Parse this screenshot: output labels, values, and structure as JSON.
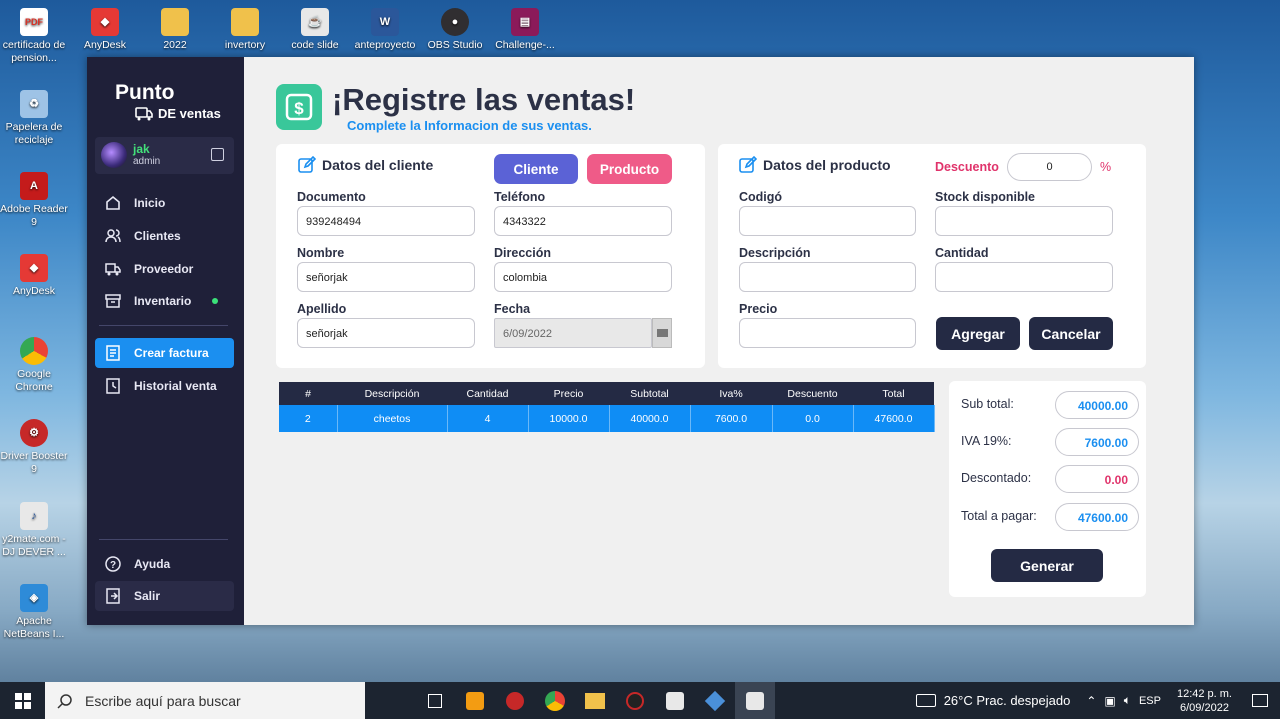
{
  "desktop_icons": [
    {
      "label": "certificado de pension...",
      "icon": "pdf-icon",
      "color": "#d93025",
      "glyph": "PDF"
    },
    {
      "label": "AnyDesk",
      "icon": "anydesk-icon",
      "color": "#e53935",
      "glyph": "◆"
    },
    {
      "label": "2022",
      "icon": "folder-icon",
      "color": "#f0c14b",
      "glyph": ""
    },
    {
      "label": "invertory",
      "icon": "folder-icon",
      "color": "#f0c14b",
      "glyph": ""
    },
    {
      "label": "code slide",
      "icon": "java-icon",
      "color": "#e8e8e8",
      "glyph": "☕"
    },
    {
      "label": "anteproyecto",
      "icon": "word-icon",
      "color": "#2b579a",
      "glyph": "W"
    },
    {
      "label": "OBS Studio",
      "icon": "obs-icon",
      "color": "#302e31",
      "glyph": "●"
    },
    {
      "label": "Challenge-...",
      "icon": "winrar-icon",
      "color": "#8b1a5a",
      "glyph": "▤"
    },
    {
      "label": "Papelera de reciclaje",
      "icon": "recycle-bin-icon",
      "color": "#9ec3e6",
      "glyph": "♻"
    },
    {
      "label": "Adobe Reader 9",
      "icon": "adobe-reader-icon",
      "color": "#c41b1b",
      "glyph": "A"
    },
    {
      "label": "AnyDesk",
      "icon": "anydesk-icon",
      "color": "#e53935",
      "glyph": "◆"
    },
    {
      "label": "Google Chrome",
      "icon": "chrome-icon",
      "color": "#4285f4",
      "glyph": "●"
    },
    {
      "label": "Driver Booster 9",
      "icon": "driver-booster-icon",
      "color": "#c62828",
      "glyph": "⚙"
    },
    {
      "label": "y2mate.com - DJ DEVER ...",
      "icon": "mp3-icon",
      "color": "#e8e8e8",
      "glyph": "♪"
    },
    {
      "label": "Apache NetBeans I...",
      "icon": "netbeans-icon",
      "color": "#2e8bd8",
      "glyph": "◈"
    }
  ],
  "sidebar": {
    "brand_line1": "Punto",
    "brand_line2": "DE ventas",
    "user_name": "jak",
    "user_role": "admin",
    "nav": [
      {
        "label": "Inicio",
        "icon": "home-icon"
      },
      {
        "label": "Clientes",
        "icon": "users-icon"
      },
      {
        "label": "Proveedor",
        "icon": "truck-icon"
      },
      {
        "label": "Inventario",
        "icon": "archive-icon"
      },
      {
        "label": "Crear factura",
        "icon": "invoice-icon"
      },
      {
        "label": "Historial venta",
        "icon": "history-icon"
      }
    ],
    "help_label": "Ayuda",
    "logout_label": "Salir"
  },
  "header": {
    "title": "¡Registre las ventas!",
    "subtitle": "Complete la Informacion de sus ventas."
  },
  "client": {
    "title": "Datos del cliente",
    "tab_cliente": "Cliente",
    "tab_producto": "Producto",
    "documento_label": "Documento",
    "documento_value": "939248494",
    "telefono_label": "Teléfono",
    "telefono_value": "4343322",
    "nombre_label": "Nombre",
    "nombre_value": "señorjak",
    "direccion_label": "Dirección",
    "direccion_value": "colombia",
    "apellido_label": "Apellido",
    "apellido_value": "señorjak",
    "fecha_label": "Fecha",
    "fecha_value": "6/09/2022"
  },
  "product": {
    "title": "Datos del producto",
    "descuento_label": "Descuento",
    "descuento_value": "0",
    "percent": "%",
    "codigo_label": "Codigó",
    "stock_label": "Stock disponible",
    "descripcion_label": "Descripción",
    "cantidad_label": "Cantidad",
    "precio_label": "Precio",
    "agregar": "Agregar",
    "cancelar": "Cancelar"
  },
  "table": {
    "headers": [
      "#",
      "Descripción",
      "Cantidad",
      "Precio",
      "Subtotal",
      "Iva%",
      "Descuento",
      "Total"
    ],
    "rows": [
      [
        "2",
        "cheetos",
        "4",
        "10000.0",
        "40000.0",
        "7600.0",
        "0.0",
        "47600.0"
      ]
    ]
  },
  "totals": {
    "subtotal_label": "Sub total:",
    "subtotal_value": "40000.00",
    "iva_label": "IVA 19%:",
    "iva_value": "7600.00",
    "descontado_label": "Descontado:",
    "descontado_value": "0.00",
    "total_label": "Total a pagar:",
    "total_value": "47600.00",
    "generar": "Generar"
  },
  "taskbar": {
    "search_placeholder": "Escribe aquí para buscar",
    "weather": "26°C  Prac. despejado",
    "lang": "ESP",
    "time": "12:42 p. m.",
    "date": "6/09/2022"
  },
  "colors": {
    "accent_blue": "#1b8ff0",
    "sidebar_bg": "#1f2039",
    "cliente_tab": "#5b62d6",
    "producto_tab": "#ef5b88",
    "descuento_pink": "#e0336b",
    "dark_button": "#242a44"
  }
}
